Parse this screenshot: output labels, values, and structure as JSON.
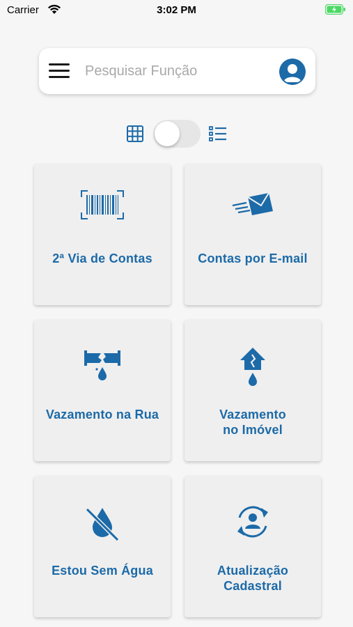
{
  "status_bar": {
    "carrier": "Carrier",
    "time": "3:02 PM"
  },
  "search": {
    "placeholder": "Pesquisar Função"
  },
  "colors": {
    "primary": "#1c6aa8",
    "card_bg": "#efefef",
    "page_bg": "#f6f6f6",
    "battery": "#4cd964"
  },
  "view_toggle": {
    "mode": "grid"
  },
  "cards": [
    {
      "label": "2ª Via de Contas",
      "icon": "barcode-icon"
    },
    {
      "label": "Contas por E-mail",
      "icon": "flying-envelope-icon"
    },
    {
      "label": "Vazamento na Rua",
      "icon": "broken-pipe-icon"
    },
    {
      "label": "Vazamento\nno Imóvel",
      "icon": "house-leak-icon"
    },
    {
      "label": "Estou Sem Água",
      "icon": "no-water-icon"
    },
    {
      "label": "Atualização\nCadastral",
      "icon": "user-update-icon"
    }
  ]
}
